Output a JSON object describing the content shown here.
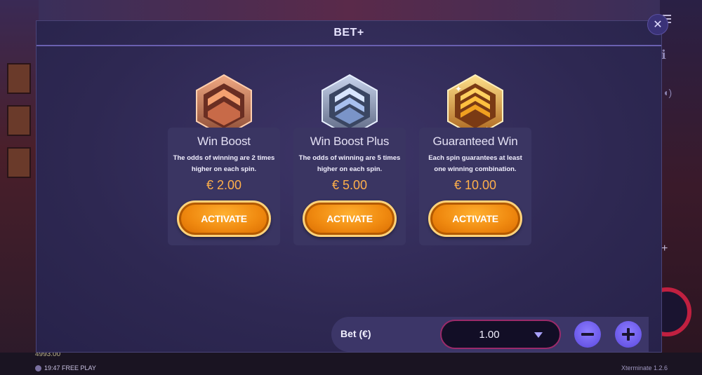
{
  "modal": {
    "title": "BET+"
  },
  "options": [
    {
      "title": "Win Boost",
      "description": "The odds of winning are 2 times higher on each spin.",
      "price": "€ 2.00",
      "button": "ACTIVATE",
      "badge": "bronze-chevron-badge-icon"
    },
    {
      "title": "Win Boost Plus",
      "description": "The odds of winning are 5 times higher on each spin.",
      "price": "€ 5.00",
      "button": "ACTIVATE",
      "badge": "silver-chevron-badge-icon"
    },
    {
      "title": "Guaranteed Win",
      "description": "Each spin guarantees at least one winning combination.",
      "price": "€ 10.00",
      "button": "ACTIVATE",
      "badge": "gold-chevron-badge-icon"
    }
  ],
  "bet": {
    "label": "Bet (€)",
    "value": "1.00"
  },
  "footer": {
    "balance": "4993.00",
    "time": "19:47 FREE PLAY",
    "version": "Xterminate 1.2.6"
  },
  "colors": {
    "accent": "#f08a10",
    "price": "#ffb04a",
    "panel": "#2e2852",
    "header_line": "#6a60b0",
    "stepper": "#7a68f0"
  }
}
